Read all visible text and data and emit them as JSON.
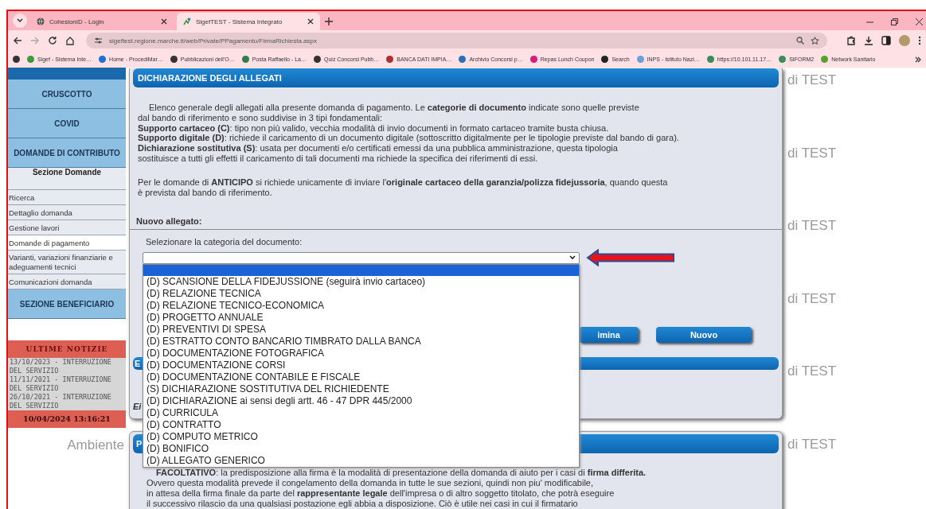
{
  "browser": {
    "tabs": [
      {
        "title": "CohesionID - Login",
        "selected": false
      },
      {
        "title": "SigefTEST - Sistema Integrato",
        "selected": true
      }
    ],
    "url": "sigeftest.regione.marche.it/web/Private/PPagamento/FirmaRichiesta.aspx",
    "bookmarks": [
      {
        "color": "#333333"
      },
      {
        "label": "Sigef - Sistema Inte…",
        "color": "#3a9a3a"
      },
      {
        "label": "Home - ProcediMar…",
        "color": "#1e6fd0"
      },
      {
        "label": "Pubblicazioni dell'O…",
        "color": "#333333"
      },
      {
        "label": "Posta Raffaello - La…",
        "color": "#2e7d4a"
      },
      {
        "label": "Quiz Concorsi Pubb…",
        "color": "#333333"
      },
      {
        "label": "BANCA DATI IMPIA…",
        "color": "#b03030"
      },
      {
        "label": "Archivio Concorsi p…",
        "color": "#2a6fb8"
      },
      {
        "label": "Repas Lunch Coupon",
        "color": "#d81b7a"
      },
      {
        "label": "Search",
        "color": "#222222"
      },
      {
        "label": "INPS - Istituto Nazi…",
        "color": "#6aa0d8"
      },
      {
        "label": "https://10.101.11.17…",
        "color": "#3c8c5a"
      },
      {
        "label": "SIFORM2",
        "color": "#3c8c5a"
      },
      {
        "label": "Network Sanitario",
        "color": "#5aa02c"
      }
    ]
  },
  "sidebar": {
    "entries": [
      {
        "kind": "button",
        "label": "CRUSCOTTO",
        "selected": false
      },
      {
        "kind": "button",
        "label": "COVID",
        "selected": false
      },
      {
        "kind": "button",
        "label": "DOMANDE DI CONTRIBUTO",
        "selected": false
      },
      {
        "kind": "heading",
        "label": "Sezione Domande"
      },
      {
        "kind": "item",
        "label": "Ricerca",
        "selected": false
      },
      {
        "kind": "item",
        "label": "Dettaglio domanda",
        "selected": false
      },
      {
        "kind": "item",
        "label": "Gestione lavori",
        "selected": false
      },
      {
        "kind": "item",
        "label": "Domande di pagamento",
        "selected": true
      },
      {
        "kind": "item",
        "label": "Varianti, variazioni finanziarie e adeguamenti tecnici",
        "selected": false
      },
      {
        "kind": "item",
        "label": "Comunicazioni domanda",
        "selected": false
      },
      {
        "kind": "button",
        "label": "SEZIONE BENEFICIARIO",
        "selected": false
      }
    ],
    "news": {
      "title": "ULTIME NOTIZIE",
      "items": [
        "13/10/2023 - INTERRUZIONE DEL SERVIZIO",
        "11/11/2021 - INTERRUZIONE DEL SERVIZIO",
        "26/10/2021 - INTERRUZIONE DEL SERVIZIO"
      ],
      "clock": "10/04/2024 13:16:21"
    },
    "environment_label": "Ambiente"
  },
  "dialog": {
    "title": "DICHIARAZIONE DEGLI ALLEGATI",
    "intro": [
      "Elenco generale degli allegati alla presente domanda di pagamento. Le **categorie di documento** indicate sono quelle previste",
      "dal bando di riferimento e sono suddivise in 3 tipi fondamentali:",
      "**Supporto cartaceo (C)**: tipo non più valido, vecchia modalità di invio documenti in formato cartaceo tramite busta chiusa.",
      "**Supporto digitale (D)**: richiede il caricamento di un documento digitale (sottoscritto digitalmente per le tipologie previste dal bando di gara).",
      "**Dichiarazione sostitutiva (S)**: usata per documenti e/o certificati emessi da una pubblica amministrazione, questa tipologia",
      "sostituisce a tutti gli effetti il caricamento di tali documenti ma richiede la specifica dei riferimenti di essi."
    ],
    "note": [
      "Per le domande di **ANTICIPO** si richiede unicamente di inviare l'**originale cartaceo della garanzia/polizza fidejussoria**, quando questa",
      "è prevista dal bando di riferimento."
    ],
    "section_label": "Nuovo allegato:",
    "field_label": "Selezionare la categoria del documento:",
    "select": {
      "expanded": true,
      "options": [
        {
          "selected": true
        },
        {
          "label": "(D) SCANSIONE DELLA FIDEJUSSIONE (seguirà invio cartaceo)",
          "selected": false
        },
        {
          "label": "(D) RELAZIONE TECNICA",
          "selected": false
        },
        {
          "label": "(D) RELAZIONE TECNICO-ECONOMICA",
          "selected": false
        },
        {
          "label": "(D) PROGETTO ANNUALE",
          "selected": false
        },
        {
          "label": "(D) PREVENTIVI DI SPESA",
          "selected": false
        },
        {
          "label": "(D) ESTRATTO CONTO BANCARIO TIMBRATO DALLA BANCA",
          "selected": false
        },
        {
          "label": "(D) DOCUMENTAZIONE FOTOGRAFICA",
          "selected": false
        },
        {
          "label": "(D) DOCUMENTAZIONE CORSI",
          "selected": false
        },
        {
          "label": "(D) DOCUMENTAZIONE CONTABILE E FISCALE",
          "selected": false
        },
        {
          "label": "(S) DICHIARAZIONE SOSTITUTIVA DEL RICHIEDENTE",
          "selected": false
        },
        {
          "label": "(D) DICHIARAZIONE ai sensi degli artt. 46 - 47 DPR 445/2000",
          "selected": false
        },
        {
          "label": "(D) CURRICULA",
          "selected": false
        },
        {
          "label": "(D) CONTRATTO",
          "selected": false
        },
        {
          "label": "(D) COMPUTO METRICO",
          "selected": false
        },
        {
          "label": "(D) BONIFICO",
          "selected": false
        },
        {
          "label": "(D) ALLEGATO GENERICO",
          "selected": false
        }
      ]
    },
    "buttons": [
      "imina",
      "Nuovo"
    ],
    "second_bar_title": "E",
    "field_text": "Ei"
  },
  "panel_2": {
    "title": "P",
    "lines": [
      "**FACOLTATIVO**: la predisposizione alla firma è la modalità di presentazione della domanda di aiuto per i casi di **firma differita.**",
      "Ovvero questa modalità prevede il congelamento della domanda in tutte le sue sezioni, quindi non piu' modificabile,",
      "in attesa della firma finale da parte del **rappresentante legale** dell'impresa o di altro soggetto titolato, che potrà eseguire",
      "il successivo rilascio da una qualsiasi postazione egli abbia a disposizione. Ciò è utile nei casi in cui il firmatario"
    ]
  },
  "background_labels": [
    "di TEST",
    "di TEST",
    "di TEST",
    "di TEST",
    "di TEST",
    "di TEST"
  ]
}
